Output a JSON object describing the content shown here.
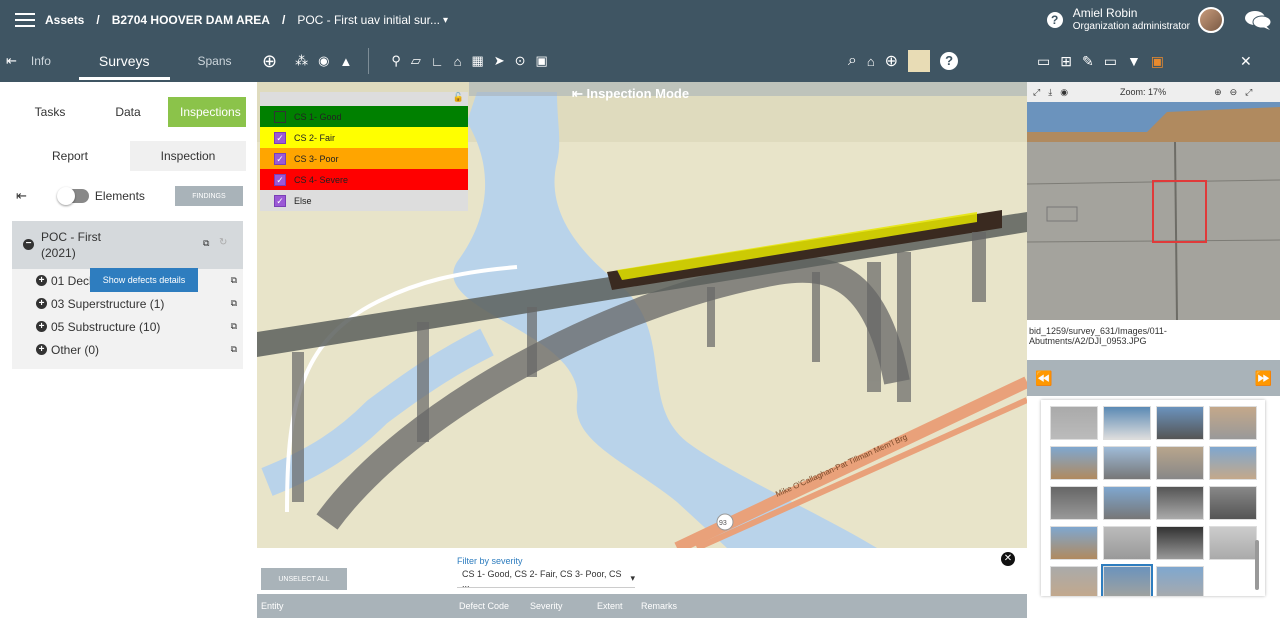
{
  "header": {
    "menu_icon": "hamburger-icon",
    "crumbs": [
      "Assets",
      "B2704 HOOVER DAM AREA",
      "POC - First uav initial sur..."
    ],
    "separator": "/",
    "dropdown_caret": "▾",
    "help": "?",
    "user_name": "Amiel Robin",
    "user_role": "Organization administrator"
  },
  "left": {
    "tabs": [
      "Info",
      "Surveys",
      "Spans"
    ],
    "subtabs": [
      "Tasks",
      "Data",
      "Inspections"
    ],
    "inner_tabs": [
      "Report",
      "Inspection"
    ],
    "elements_label": "Elements",
    "findings_button": "FINDINGS",
    "tree_title": "POC - First",
    "tree_year": "(2021)",
    "tooltip": "Show defects details",
    "items": [
      "01 Decks and Slabs (7)",
      "03 Superstructure (1)",
      "05 Substructure (10)",
      "Other (0)"
    ]
  },
  "map": {
    "mode_label": "Inspection Mode",
    "legend": [
      {
        "label": "CS 1- Good",
        "checked": false,
        "color": "#008000"
      },
      {
        "label": "CS 2- Fair",
        "checked": true,
        "color": "#ffff00"
      },
      {
        "label": "CS 3- Poor",
        "checked": true,
        "color": "#ffa500"
      },
      {
        "label": "CS 4- Severe",
        "checked": true,
        "color": "#ff0000"
      },
      {
        "label": "Else",
        "checked": true,
        "color": "#dddddd"
      }
    ],
    "road_label": "Mike O'Callaghan-Pat Tillman Mem'l Brg",
    "shield": "93"
  },
  "filter": {
    "unselect_button": "UNSELECT ALL",
    "label": "Filter by severity",
    "value": "CS 1- Good, CS 2- Fair, CS 3- Poor, CS ...",
    "columns": [
      "Entity",
      "Defect Code",
      "Severity",
      "Extent",
      "Remarks"
    ]
  },
  "viewer": {
    "zoom": "Zoom: 17%",
    "path": "bid_1259/survey_631/Images/011-Abutments/A2/DJI_0953.JPG"
  },
  "colors": {
    "header": "#3f5563",
    "accent": "#8bc34a",
    "tooltip": "#2e7dbf"
  }
}
